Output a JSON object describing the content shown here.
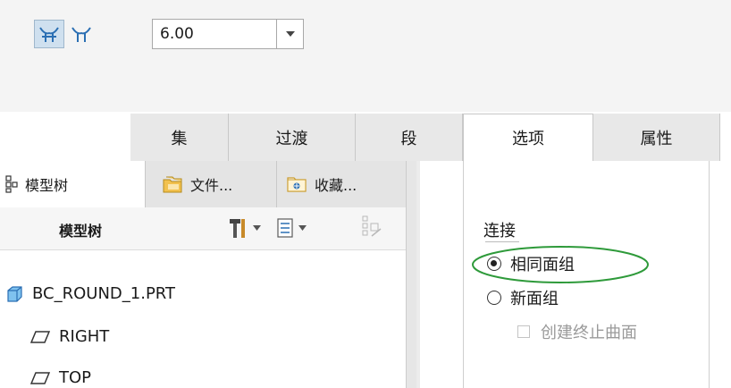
{
  "toolbar": {
    "icons": [
      "chain-fillet-icon",
      "single-fillet-icon"
    ],
    "value": "6.00",
    "dropdown_icon": "chevron-down-icon"
  },
  "tabs": [
    {
      "label": "集",
      "selected": false
    },
    {
      "label": "过渡",
      "selected": false
    },
    {
      "label": "段",
      "selected": false
    },
    {
      "label": "选项",
      "selected": true
    },
    {
      "label": "属性",
      "selected": false
    }
  ],
  "options": {
    "group_label": "连接",
    "radio_same": "相同面组",
    "radio_new": "新面组",
    "checkbox_label": "创建终止曲面",
    "selected": "相同面组",
    "highlight_color": "#2e9a3a"
  },
  "tree": {
    "tabs": [
      {
        "label": "模型树",
        "icon": "model-tree-icon"
      },
      {
        "label": "文件...",
        "icon": "folder-icon"
      },
      {
        "label": "收藏...",
        "icon": "favorites-icon"
      }
    ],
    "toolbar_label": "模型树",
    "nodes": [
      {
        "label": "BC_ROUND_1.PRT",
        "icon": "part-icon"
      },
      {
        "label": "RIGHT",
        "icon": "datum-plane-icon"
      },
      {
        "label": "TOP",
        "icon": "datum-plane-icon"
      }
    ]
  }
}
